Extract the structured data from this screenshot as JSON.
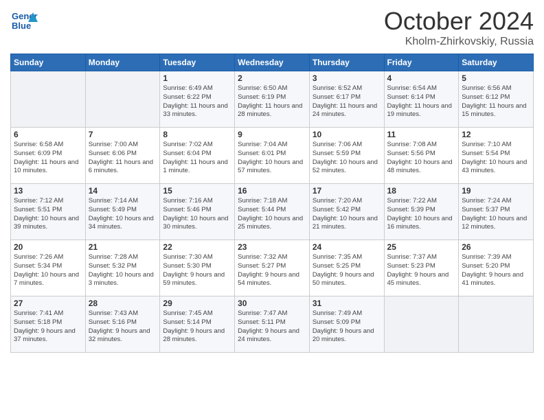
{
  "header": {
    "logo_line1": "General",
    "logo_line2": "Blue",
    "month": "October 2024",
    "location": "Kholm-Zhirkovskiy, Russia"
  },
  "weekdays": [
    "Sunday",
    "Monday",
    "Tuesday",
    "Wednesday",
    "Thursday",
    "Friday",
    "Saturday"
  ],
  "weeks": [
    [
      {
        "day": "",
        "sunrise": "",
        "sunset": "",
        "daylight": ""
      },
      {
        "day": "",
        "sunrise": "",
        "sunset": "",
        "daylight": ""
      },
      {
        "day": "1",
        "sunrise": "Sunrise: 6:49 AM",
        "sunset": "Sunset: 6:22 PM",
        "daylight": "Daylight: 11 hours and 33 minutes."
      },
      {
        "day": "2",
        "sunrise": "Sunrise: 6:50 AM",
        "sunset": "Sunset: 6:19 PM",
        "daylight": "Daylight: 11 hours and 28 minutes."
      },
      {
        "day": "3",
        "sunrise": "Sunrise: 6:52 AM",
        "sunset": "Sunset: 6:17 PM",
        "daylight": "Daylight: 11 hours and 24 minutes."
      },
      {
        "day": "4",
        "sunrise": "Sunrise: 6:54 AM",
        "sunset": "Sunset: 6:14 PM",
        "daylight": "Daylight: 11 hours and 19 minutes."
      },
      {
        "day": "5",
        "sunrise": "Sunrise: 6:56 AM",
        "sunset": "Sunset: 6:12 PM",
        "daylight": "Daylight: 11 hours and 15 minutes."
      }
    ],
    [
      {
        "day": "6",
        "sunrise": "Sunrise: 6:58 AM",
        "sunset": "Sunset: 6:09 PM",
        "daylight": "Daylight: 11 hours and 10 minutes."
      },
      {
        "day": "7",
        "sunrise": "Sunrise: 7:00 AM",
        "sunset": "Sunset: 6:06 PM",
        "daylight": "Daylight: 11 hours and 6 minutes."
      },
      {
        "day": "8",
        "sunrise": "Sunrise: 7:02 AM",
        "sunset": "Sunset: 6:04 PM",
        "daylight": "Daylight: 11 hours and 1 minute."
      },
      {
        "day": "9",
        "sunrise": "Sunrise: 7:04 AM",
        "sunset": "Sunset: 6:01 PM",
        "daylight": "Daylight: 10 hours and 57 minutes."
      },
      {
        "day": "10",
        "sunrise": "Sunrise: 7:06 AM",
        "sunset": "Sunset: 5:59 PM",
        "daylight": "Daylight: 10 hours and 52 minutes."
      },
      {
        "day": "11",
        "sunrise": "Sunrise: 7:08 AM",
        "sunset": "Sunset: 5:56 PM",
        "daylight": "Daylight: 10 hours and 48 minutes."
      },
      {
        "day": "12",
        "sunrise": "Sunrise: 7:10 AM",
        "sunset": "Sunset: 5:54 PM",
        "daylight": "Daylight: 10 hours and 43 minutes."
      }
    ],
    [
      {
        "day": "13",
        "sunrise": "Sunrise: 7:12 AM",
        "sunset": "Sunset: 5:51 PM",
        "daylight": "Daylight: 10 hours and 39 minutes."
      },
      {
        "day": "14",
        "sunrise": "Sunrise: 7:14 AM",
        "sunset": "Sunset: 5:49 PM",
        "daylight": "Daylight: 10 hours and 34 minutes."
      },
      {
        "day": "15",
        "sunrise": "Sunrise: 7:16 AM",
        "sunset": "Sunset: 5:46 PM",
        "daylight": "Daylight: 10 hours and 30 minutes."
      },
      {
        "day": "16",
        "sunrise": "Sunrise: 7:18 AM",
        "sunset": "Sunset: 5:44 PM",
        "daylight": "Daylight: 10 hours and 25 minutes."
      },
      {
        "day": "17",
        "sunrise": "Sunrise: 7:20 AM",
        "sunset": "Sunset: 5:42 PM",
        "daylight": "Daylight: 10 hours and 21 minutes."
      },
      {
        "day": "18",
        "sunrise": "Sunrise: 7:22 AM",
        "sunset": "Sunset: 5:39 PM",
        "daylight": "Daylight: 10 hours and 16 minutes."
      },
      {
        "day": "19",
        "sunrise": "Sunrise: 7:24 AM",
        "sunset": "Sunset: 5:37 PM",
        "daylight": "Daylight: 10 hours and 12 minutes."
      }
    ],
    [
      {
        "day": "20",
        "sunrise": "Sunrise: 7:26 AM",
        "sunset": "Sunset: 5:34 PM",
        "daylight": "Daylight: 10 hours and 7 minutes."
      },
      {
        "day": "21",
        "sunrise": "Sunrise: 7:28 AM",
        "sunset": "Sunset: 5:32 PM",
        "daylight": "Daylight: 10 hours and 3 minutes."
      },
      {
        "day": "22",
        "sunrise": "Sunrise: 7:30 AM",
        "sunset": "Sunset: 5:30 PM",
        "daylight": "Daylight: 9 hours and 59 minutes."
      },
      {
        "day": "23",
        "sunrise": "Sunrise: 7:32 AM",
        "sunset": "Sunset: 5:27 PM",
        "daylight": "Daylight: 9 hours and 54 minutes."
      },
      {
        "day": "24",
        "sunrise": "Sunrise: 7:35 AM",
        "sunset": "Sunset: 5:25 PM",
        "daylight": "Daylight: 9 hours and 50 minutes."
      },
      {
        "day": "25",
        "sunrise": "Sunrise: 7:37 AM",
        "sunset": "Sunset: 5:23 PM",
        "daylight": "Daylight: 9 hours and 45 minutes."
      },
      {
        "day": "26",
        "sunrise": "Sunrise: 7:39 AM",
        "sunset": "Sunset: 5:20 PM",
        "daylight": "Daylight: 9 hours and 41 minutes."
      }
    ],
    [
      {
        "day": "27",
        "sunrise": "Sunrise: 7:41 AM",
        "sunset": "Sunset: 5:18 PM",
        "daylight": "Daylight: 9 hours and 37 minutes."
      },
      {
        "day": "28",
        "sunrise": "Sunrise: 7:43 AM",
        "sunset": "Sunset: 5:16 PM",
        "daylight": "Daylight: 9 hours and 32 minutes."
      },
      {
        "day": "29",
        "sunrise": "Sunrise: 7:45 AM",
        "sunset": "Sunset: 5:14 PM",
        "daylight": "Daylight: 9 hours and 28 minutes."
      },
      {
        "day": "30",
        "sunrise": "Sunrise: 7:47 AM",
        "sunset": "Sunset: 5:11 PM",
        "daylight": "Daylight: 9 hours and 24 minutes."
      },
      {
        "day": "31",
        "sunrise": "Sunrise: 7:49 AM",
        "sunset": "Sunset: 5:09 PM",
        "daylight": "Daylight: 9 hours and 20 minutes."
      },
      {
        "day": "",
        "sunrise": "",
        "sunset": "",
        "daylight": ""
      },
      {
        "day": "",
        "sunrise": "",
        "sunset": "",
        "daylight": ""
      }
    ]
  ]
}
